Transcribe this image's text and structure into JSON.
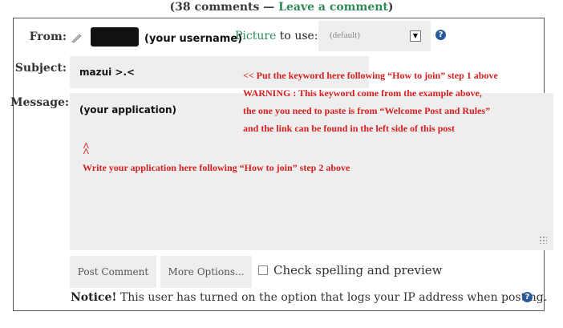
{
  "header": {
    "open": "(",
    "count_text": "38 comments",
    "dash": " — ",
    "leave_link": "Leave a comment",
    "close": ")"
  },
  "from": {
    "label": "From:",
    "username_hint": "(your username)"
  },
  "picture": {
    "link": "Picture",
    "text": " to use:",
    "select_value": "(default)"
  },
  "subject": {
    "label": "Subject:",
    "value": "mazui >.<"
  },
  "message": {
    "label": "Message:",
    "value": "(your application)"
  },
  "annotations": {
    "line1": "<< Put the keyword here following “How to join” step 1 above",
    "line2": "WARNING : This keyword come from the example above,",
    "line3": "the one you need to paste is from “Welcome Post and Rules”",
    "line4": "and the link can be found in the left side of this post",
    "caret": "^",
    "line5": "Write your application here following “How to join” step 2 above"
  },
  "buttons": {
    "post": "Post Comment",
    "more": "More Options..."
  },
  "spellcheck_label": "Check spelling and preview",
  "notice": {
    "bold": "Notice!",
    "text": " This user has turned on the option that logs your IP address when posting."
  },
  "colors": {
    "accent_green": "#2e8b57",
    "annotation_red": "#d42020",
    "help_blue": "#2a5a9a",
    "field_bg": "#eeeeee"
  }
}
